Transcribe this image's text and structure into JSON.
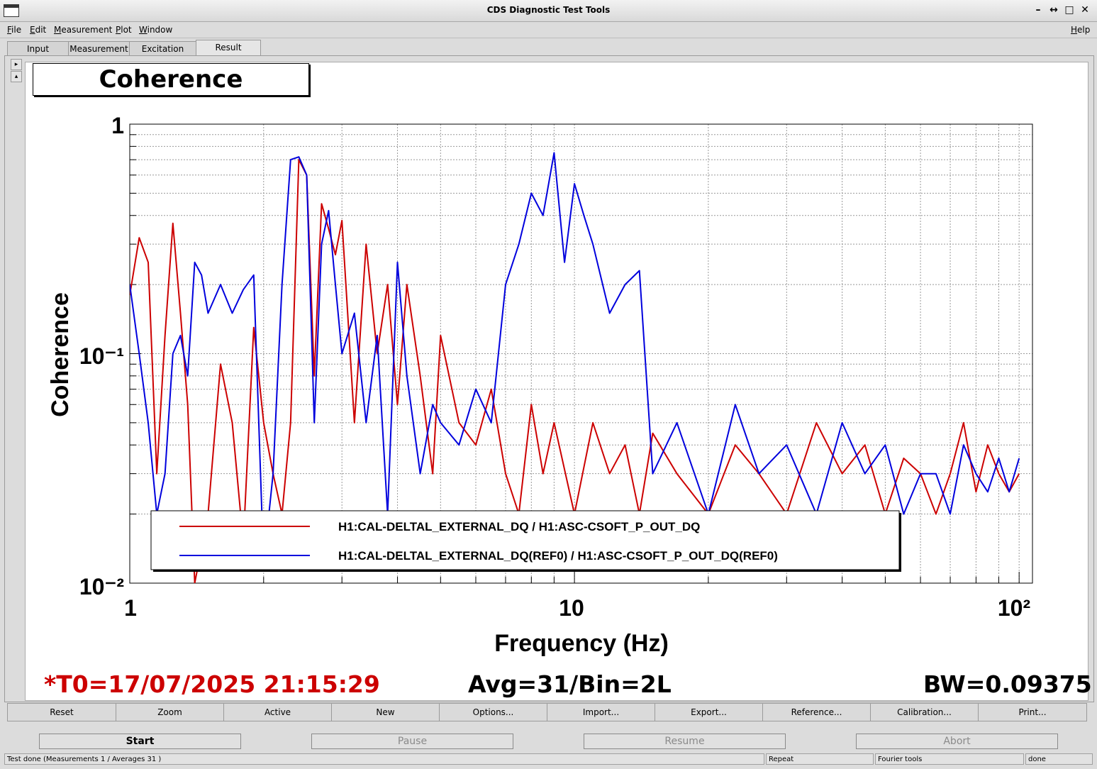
{
  "window": {
    "title": "CDS Diagnostic Test Tools"
  },
  "menu": {
    "file": "File",
    "edit": "Edit",
    "measurement": "Measurement",
    "plot": "Plot",
    "window": "Window",
    "help": "Help"
  },
  "tabs": [
    {
      "label": "Input"
    },
    {
      "label": "Measurement"
    },
    {
      "label": "Excitation"
    },
    {
      "label": "Result"
    }
  ],
  "plot": {
    "title": "Coherence",
    "t0": "*T0=17/07/2025 21:15:29",
    "avg": "Avg=31/Bin=2L",
    "bw": "BW=0.09375"
  },
  "colors": {
    "red": "#cc0000",
    "blue": "#0000dd"
  },
  "chart_data": {
    "type": "line",
    "xscale": "log",
    "yscale": "log",
    "xlabel": "Frequency (Hz)",
    "ylabel": "Coherence",
    "xlim": [
      1,
      100
    ],
    "ylim": [
      0.01,
      1
    ],
    "x_ticklabels": [
      "1",
      "10",
      "10²"
    ],
    "y_ticklabels": [
      "1",
      "10⁻¹",
      "10⁻²"
    ],
    "grid": true,
    "legend_position": "bottom",
    "series": [
      {
        "name": "H1:CAL-DELTAL_EXTERNAL_DQ / H1:ASC-CSOFT_P_OUT_DQ",
        "color": "#cc0000",
        "x": [
          1.0,
          1.05,
          1.1,
          1.15,
          1.2,
          1.25,
          1.3,
          1.35,
          1.4,
          1.5,
          1.6,
          1.7,
          1.8,
          1.9,
          2.0,
          2.1,
          2.2,
          2.3,
          2.4,
          2.5,
          2.6,
          2.7,
          2.8,
          2.9,
          3.0,
          3.2,
          3.4,
          3.6,
          3.8,
          4.0,
          4.2,
          4.5,
          4.8,
          5.0,
          5.5,
          6.0,
          6.5,
          7.0,
          7.5,
          8.0,
          8.5,
          9.0,
          10,
          11,
          12,
          13,
          14,
          15,
          17,
          20,
          23,
          26,
          30,
          35,
          40,
          45,
          50,
          55,
          60,
          65,
          70,
          75,
          80,
          85,
          90,
          95,
          100
        ],
        "y": [
          0.18,
          0.32,
          0.25,
          0.03,
          0.12,
          0.37,
          0.15,
          0.06,
          0.01,
          0.02,
          0.09,
          0.05,
          0.015,
          0.13,
          0.05,
          0.03,
          0.02,
          0.05,
          0.7,
          0.6,
          0.08,
          0.45,
          0.35,
          0.27,
          0.38,
          0.05,
          0.3,
          0.1,
          0.2,
          0.06,
          0.2,
          0.08,
          0.03,
          0.12,
          0.05,
          0.04,
          0.07,
          0.03,
          0.02,
          0.06,
          0.03,
          0.05,
          0.02,
          0.05,
          0.03,
          0.04,
          0.02,
          0.045,
          0.03,
          0.02,
          0.04,
          0.03,
          0.02,
          0.05,
          0.03,
          0.04,
          0.02,
          0.035,
          0.03,
          0.02,
          0.03,
          0.05,
          0.025,
          0.04,
          0.03,
          0.025,
          0.03
        ]
      },
      {
        "name": "H1:CAL-DELTAL_EXTERNAL_DQ(REF0) / H1:ASC-CSOFT_P_OUT_DQ(REF0)",
        "color": "#0000dd",
        "x": [
          1.0,
          1.05,
          1.1,
          1.15,
          1.2,
          1.25,
          1.3,
          1.35,
          1.4,
          1.45,
          1.5,
          1.6,
          1.7,
          1.8,
          1.9,
          2.0,
          2.1,
          2.2,
          2.3,
          2.4,
          2.5,
          2.6,
          2.7,
          2.8,
          2.9,
          3.0,
          3.2,
          3.4,
          3.6,
          3.8,
          4.0,
          4.2,
          4.5,
          4.8,
          5.0,
          5.5,
          6.0,
          6.5,
          7.0,
          7.5,
          8.0,
          8.5,
          9.0,
          9.5,
          10,
          10.5,
          11,
          12,
          13,
          14,
          15,
          17,
          20,
          23,
          26,
          30,
          35,
          40,
          45,
          50,
          55,
          60,
          65,
          70,
          75,
          80,
          85,
          90,
          95,
          100
        ],
        "y": [
          0.2,
          0.1,
          0.05,
          0.02,
          0.03,
          0.1,
          0.12,
          0.08,
          0.25,
          0.22,
          0.15,
          0.2,
          0.15,
          0.19,
          0.22,
          0.012,
          0.03,
          0.2,
          0.7,
          0.72,
          0.6,
          0.05,
          0.3,
          0.42,
          0.2,
          0.1,
          0.15,
          0.05,
          0.12,
          0.02,
          0.25,
          0.08,
          0.03,
          0.06,
          0.05,
          0.04,
          0.07,
          0.05,
          0.2,
          0.3,
          0.5,
          0.4,
          0.75,
          0.25,
          0.55,
          0.4,
          0.3,
          0.15,
          0.2,
          0.23,
          0.03,
          0.05,
          0.02,
          0.06,
          0.03,
          0.04,
          0.02,
          0.05,
          0.03,
          0.04,
          0.02,
          0.03,
          0.03,
          0.02,
          0.04,
          0.03,
          0.025,
          0.035,
          0.025,
          0.035
        ]
      }
    ]
  },
  "actions": [
    {
      "label": "Reset"
    },
    {
      "label": "Zoom"
    },
    {
      "label": "Active"
    },
    {
      "label": "New"
    },
    {
      "label": "Options..."
    },
    {
      "label": "Import..."
    },
    {
      "label": "Export..."
    },
    {
      "label": "Reference..."
    },
    {
      "label": "Calibration..."
    },
    {
      "label": "Print..."
    }
  ],
  "controls": {
    "start": "Start",
    "pause": "Pause",
    "resume": "Resume",
    "abort": "Abort"
  },
  "status": {
    "message": "Test done (Measurements 1 / Averages 31 )",
    "mode": "Repeat",
    "tool": "Fourier tools",
    "state": "done"
  }
}
